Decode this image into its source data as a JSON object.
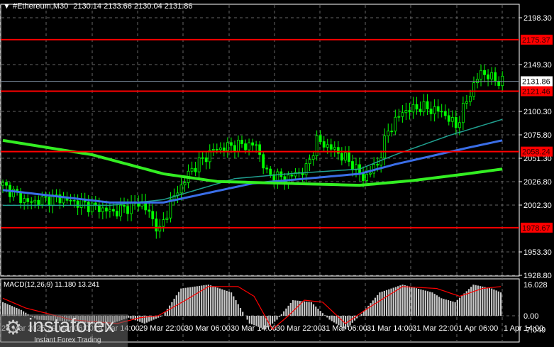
{
  "header": {
    "symbol": "#Ethereum,M30",
    "ohlc": "2130.14 2133.66 2130.04 2131.86"
  },
  "chart_data": {
    "type": "candlestick",
    "symbol": "#Ethereum",
    "timeframe": "M30",
    "ylim": [
      1928.8,
      2198.3
    ],
    "y_ticks": [
      "2198.30",
      "2149.30",
      "2100.30",
      "2075.80",
      "2051.30",
      "2026.80",
      "2002.30",
      "1953.30",
      "1928.80"
    ],
    "current_price": "2131.86",
    "levels": [
      {
        "label": "2175.37",
        "value": 2175.37
      },
      {
        "label": "2121.46",
        "value": 2121.46
      },
      {
        "label": "2058.24",
        "value": 2058.24
      },
      {
        "label": "1978.67",
        "value": 1978.67
      }
    ],
    "x_ticks": [
      "28 Mar 2025",
      "29 Mar 06:00",
      "29 Mar 14:00",
      "29 Mar 22:00",
      "30 Mar 06:00",
      "30 Mar 14:00",
      "30 Mar 22:00",
      "31 Mar 06:00",
      "31 Mar 14:00",
      "31 Mar 22:00",
      "1 Apr 06:00",
      "1 Apr 14:00"
    ],
    "price_path": [
      [
        0,
        2023
      ],
      [
        7,
        2005
      ],
      [
        15,
        2010
      ],
      [
        23,
        2003
      ],
      [
        31,
        1995
      ],
      [
        39,
        2005
      ],
      [
        44,
        1975
      ],
      [
        47,
        2005
      ],
      [
        53,
        2040
      ],
      [
        59,
        2060
      ],
      [
        65,
        2065
      ],
      [
        71,
        2065
      ],
      [
        74,
        2035
      ],
      [
        79,
        2030
      ],
      [
        85,
        2040
      ],
      [
        88,
        2070
      ],
      [
        93,
        2060
      ],
      [
        98,
        2045
      ],
      [
        101,
        2030
      ],
      [
        105,
        2045
      ],
      [
        108,
        2080
      ],
      [
        112,
        2100
      ],
      [
        117,
        2105
      ],
      [
        123,
        2100
      ],
      [
        127,
        2085
      ],
      [
        131,
        2120
      ],
      [
        134,
        2142
      ],
      [
        137,
        2135
      ],
      [
        140,
        2131
      ]
    ],
    "ma_slow": [
      [
        0,
        2070
      ],
      [
        25,
        2055
      ],
      [
        45,
        2035
      ],
      [
        60,
        2027
      ],
      [
        80,
        2025
      ],
      [
        100,
        2023
      ],
      [
        115,
        2028
      ],
      [
        130,
        2035
      ],
      [
        140,
        2040
      ]
    ],
    "ma_mid": [
      [
        0,
        2018
      ],
      [
        30,
        2005
      ],
      [
        45,
        2005
      ],
      [
        70,
        2025
      ],
      [
        100,
        2035
      ],
      [
        110,
        2045
      ],
      [
        130,
        2062
      ],
      [
        140,
        2070
      ]
    ],
    "ma_fast": [
      [
        0,
        2002
      ],
      [
        30,
        2002
      ],
      [
        45,
        2008
      ],
      [
        65,
        2030
      ],
      [
        80,
        2035
      ],
      [
        100,
        2040
      ],
      [
        110,
        2055
      ],
      [
        125,
        2075
      ],
      [
        140,
        2092
      ]
    ],
    "macd": {
      "label": "MACD(12,26,9) 11.180 13.241",
      "ticks": [
        "16.028",
        "0.00",
        "-7.049"
      ],
      "ylim": [
        -7.049,
        16.028
      ],
      "hist_path": [
        [
          0,
          7
        ],
        [
          8,
          3
        ],
        [
          15,
          -2
        ],
        [
          30,
          -3
        ],
        [
          45,
          -5
        ],
        [
          55,
          -1
        ],
        [
          62,
          -4
        ],
        [
          70,
          0
        ],
        [
          78,
          14
        ],
        [
          90,
          16
        ],
        [
          100,
          12
        ],
        [
          108,
          -4
        ],
        [
          115,
          -7
        ],
        [
          120,
          -2
        ],
        [
          127,
          8
        ],
        [
          135,
          7
        ],
        [
          143,
          -2
        ],
        [
          150,
          -7
        ],
        [
          157,
          1
        ],
        [
          165,
          12
        ],
        [
          175,
          16
        ],
        [
          188,
          12
        ],
        [
          192,
          9
        ],
        [
          198,
          7
        ],
        [
          206,
          16
        ],
        [
          214,
          14
        ],
        [
          218,
          12
        ]
      ],
      "signal_path": [
        [
          0,
          9
        ],
        [
          10,
          4
        ],
        [
          30,
          -2
        ],
        [
          50,
          -4
        ],
        [
          60,
          -1
        ],
        [
          68,
          0
        ],
        [
          80,
          8
        ],
        [
          90,
          15
        ],
        [
          103,
          15
        ],
        [
          110,
          10
        ],
        [
          118,
          -7
        ],
        [
          125,
          0
        ],
        [
          132,
          8
        ],
        [
          140,
          7
        ],
        [
          150,
          -4
        ],
        [
          160,
          4
        ],
        [
          175,
          15
        ],
        [
          190,
          14
        ],
        [
          200,
          10
        ],
        [
          210,
          14
        ],
        [
          218,
          15
        ]
      ]
    }
  },
  "watermark": {
    "brand": "instaforex",
    "tagline": "Instant Forex Trading"
  }
}
